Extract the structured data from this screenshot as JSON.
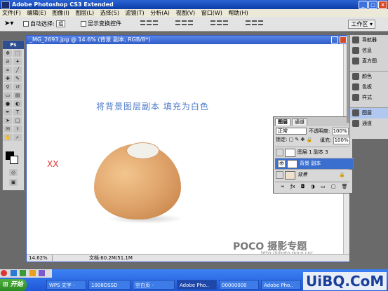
{
  "app": {
    "title": "Adobe Photoshop CS3 Extended",
    "window_buttons": [
      "_",
      "□",
      "×"
    ]
  },
  "menu": [
    "文件(F)",
    "编辑(E)",
    "图像(I)",
    "图层(L)",
    "选择(S)",
    "滤镜(T)",
    "分析(A)",
    "视图(V)",
    "窗口(W)",
    "帮助(H)"
  ],
  "options": {
    "auto_select_label": "自动选择:",
    "auto_select_value": "组",
    "show_transform_label": "显示变换控件",
    "workspace_label": "工作区 ▾"
  },
  "toolbox": {
    "header": "Ps"
  },
  "document": {
    "title": "_MG_2693.jpg @ 14.6% (背景 副本, RGB/8*)",
    "zoom": "14.62%",
    "status": "文档:60.2M/51.1M",
    "banner": "将背景图层副本   填充为白色",
    "marker": "XX",
    "watermark": "POCO 摄影专题",
    "watermark_sub": "http://photo.poco.cn/"
  },
  "layers_panel": {
    "tabs": [
      "图层",
      "通道"
    ],
    "blend_mode": "正常",
    "opacity_label": "不透明度:",
    "opacity_value": "100%",
    "lock_label": "锁定:",
    "fill_label": "填充:",
    "fill_value": "100%",
    "layers": [
      {
        "name": "图层 1 副本 3",
        "visible": false,
        "selected": false
      },
      {
        "name": "背景 副本",
        "visible": true,
        "selected": true
      },
      {
        "name": "背景",
        "visible": false,
        "selected": false
      }
    ]
  },
  "dock": {
    "items": [
      "导航器",
      "信息",
      "直方图",
      "颜色",
      "色板",
      "样式",
      "图层",
      "通道"
    ],
    "active": "图层"
  },
  "taskbar": {
    "start_label": "开始",
    "tasks": [
      "WPS 文字 -",
      "1008DSSD",
      "空白页 -",
      "Adobe Pho..",
      "00000000",
      "Adobe Pho.."
    ]
  },
  "site_logo": "UiBQ.CoM",
  "colors": {
    "banner": "#4a7ac8",
    "marker": "#e33333",
    "selected_layer": "#3a6fd0",
    "taskbar": "#1f58d8"
  }
}
